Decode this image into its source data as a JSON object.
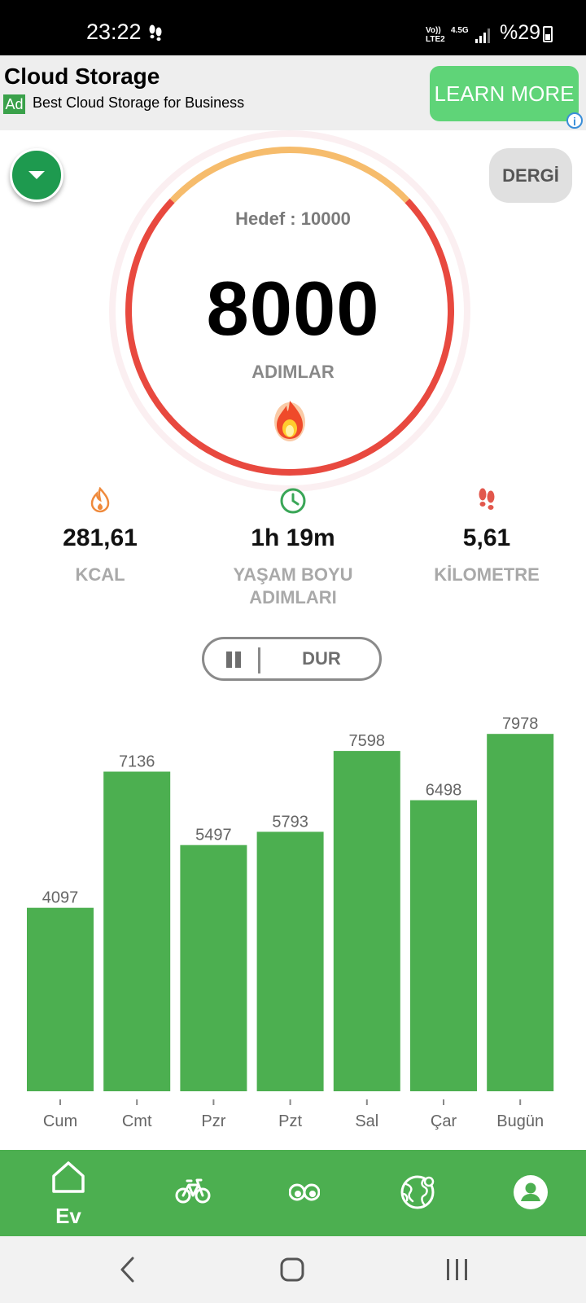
{
  "status_bar": {
    "time": "23:22",
    "network_label": "Vo)) LTE2",
    "network_type": "4.5G",
    "battery": "%29"
  },
  "ad": {
    "title": "Cloud Storage",
    "badge": "Ad",
    "subtitle": "Best Cloud Storage for Business",
    "cta": "LEARN MORE",
    "info_icon": "i"
  },
  "header": {
    "dergi_label": "DERGİ"
  },
  "progress": {
    "goal_label": "Hedef : 10000",
    "goal": 10000,
    "steps": "8000",
    "steps_label": "ADIMLAR",
    "fraction": 0.8,
    "colors": {
      "ring_done": "#e8493f",
      "ring_remaining": "#f6bc6c",
      "halo": "#fbeff1"
    }
  },
  "stats": [
    {
      "icon": "flame-icon",
      "value": "281,61",
      "label": "KCAL",
      "color": "#ef8a3c"
    },
    {
      "icon": "clock-icon",
      "value": "1h 19m",
      "label": "YAŞAM BOYU ADIMLARI",
      "color": "#3aa657"
    },
    {
      "icon": "footprints-icon",
      "value": "5,61",
      "label": "KİLOMETRE",
      "color": "#e2574c"
    }
  ],
  "control": {
    "pause_label": "DUR"
  },
  "chart_data": {
    "type": "bar",
    "categories": [
      "Cum",
      "Cmt",
      "Pzr",
      "Pzt",
      "Sal",
      "Çar",
      "Bugün"
    ],
    "values": [
      4097,
      7136,
      5497,
      5793,
      7598,
      6498,
      7978
    ],
    "data_labels": [
      "4097",
      "7136",
      "5497",
      "5793",
      "7598",
      "6498",
      "7978"
    ],
    "ylim": [
      0,
      8000
    ],
    "grid": false,
    "bar_color": "#4caf50"
  },
  "bottom_nav": {
    "items": [
      {
        "icon": "home-icon",
        "label": "Ev",
        "active": true
      },
      {
        "icon": "bicycle-icon",
        "label": ""
      },
      {
        "icon": "eyes-icon",
        "label": ""
      },
      {
        "icon": "globe-icon",
        "label": ""
      },
      {
        "icon": "profile-icon",
        "label": ""
      }
    ],
    "color": "#4caf50"
  }
}
